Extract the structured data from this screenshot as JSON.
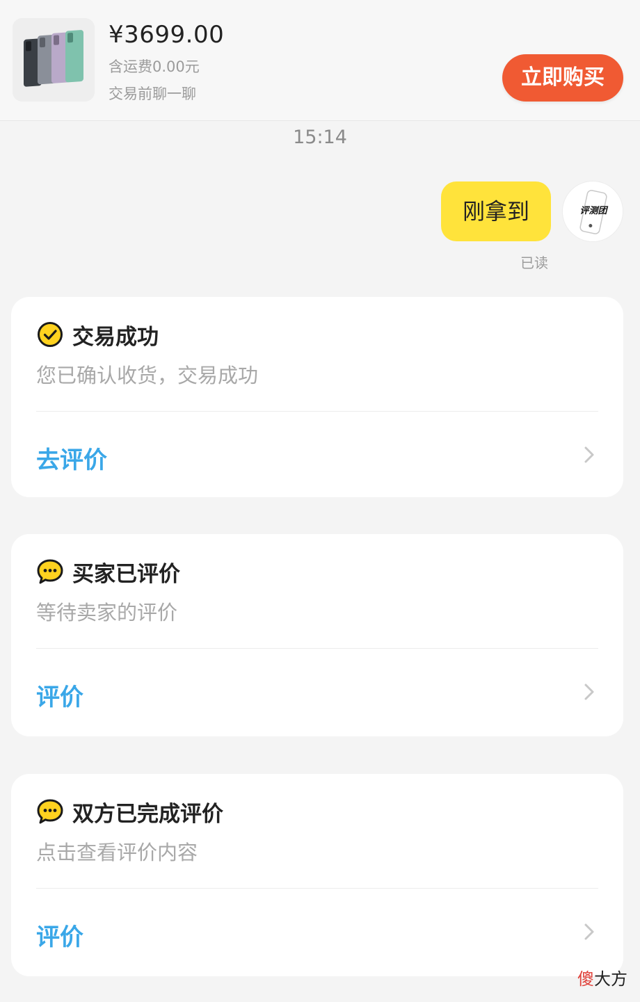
{
  "product": {
    "price": "¥3699.00",
    "shipping": "含运费0.00元",
    "chat_hint": "交易前聊一聊",
    "buy_label": "立即购买"
  },
  "chat": {
    "time": "15:14",
    "message": "刚拿到",
    "read_status": "已读",
    "avatar_text": "评测团"
  },
  "cards": [
    {
      "icon": "check-circle-icon",
      "title": "交易成功",
      "subtitle": "您已确认收货，交易成功",
      "action": "去评价"
    },
    {
      "icon": "chat-bubble-icon",
      "title": "买家已评价",
      "subtitle": "等待卖家的评价",
      "action": "评价"
    },
    {
      "icon": "chat-bubble-icon",
      "title": "双方已完成评价",
      "subtitle": "点击查看评价内容",
      "action": "评价"
    }
  ],
  "watermark": {
    "accent": "傻",
    "rest": "大方"
  },
  "colors": {
    "buy_button": "#f05a33",
    "bubble": "#ffe33b",
    "action_link": "#3aa7e8",
    "icon_yellow": "#ffd21f"
  }
}
